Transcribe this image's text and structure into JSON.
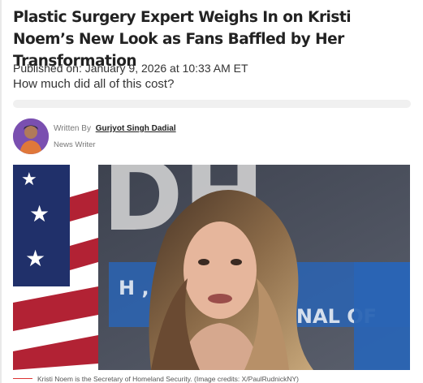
{
  "article": {
    "title": "Plastic Surgery Expert Weighs In on Kristi Noem’s New Look as Fans Baffled by Her Transformation",
    "published": "Published on: January 9, 2026 at 10:33 AM ET",
    "subtitle": "How much did all of this cost?"
  },
  "author": {
    "written_by": "Written By",
    "name": "Gurjyot Singh Dadial",
    "role": "News Writer"
  },
  "image": {
    "caption": "Kristi Noem is the Secretary of Homeland Security. (Image credits: X/PaulRudnickNY)",
    "background_text": "DH",
    "sign_line1": "H   , DISRUP",
    "sign_line2": "INAL OF"
  },
  "colors": {
    "flag_red": "#b22234",
    "flag_blue": "#20306a",
    "sign_blue": "#2a64b4"
  }
}
